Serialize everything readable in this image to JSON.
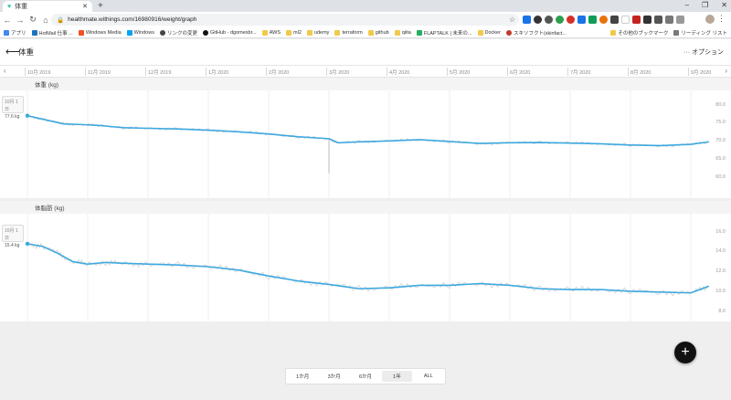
{
  "browser": {
    "tab_title": "体重",
    "url": "healthmate.withings.com/16980916/weight/graph",
    "bookmarks": [
      "アプリ",
      "HotMail 仕事 ...",
      "Windows Media",
      "Windows",
      "リンクの変更",
      "GitHub - dgomesbr...",
      "AWS",
      "ml2",
      "udemy",
      "terraform",
      "github",
      "qiita",
      "FLAPTALK | 未来の...",
      "Docker",
      "スキソフクト(skinfact..."
    ],
    "bookmarks_right": [
      "その他のブックマーク",
      "リーディング リスト"
    ]
  },
  "colors": {
    "series": "#3da9e0",
    "raw": "#cccccc"
  },
  "app": {
    "back_icon": "arrow-left-icon",
    "title": "体重",
    "options": "··· オプション",
    "timeline_months": [
      "10月 2019",
      "11月 2019",
      "12月 2019",
      "1月 2020",
      "2月 2020",
      "3月 2020",
      "4月 2020",
      "5月 2020",
      "6月 2020",
      "7月 2020",
      "8月 2020",
      "9月 2020"
    ]
  },
  "weight_section": {
    "header": "体重 (kg)",
    "tooltip_date": "10月 1日",
    "tooltip_value": "77.6 kg",
    "y_ticks": [
      "80.0",
      "75.0",
      "70.0",
      "65.0",
      "60.0"
    ]
  },
  "fat_section": {
    "header": "体脂肪 (kg)",
    "tooltip_date": "10月 1日",
    "tooltip_value": "15.4 kg",
    "y_ticks": [
      "16.0",
      "14.0",
      "12.0",
      "10.0",
      "8.0"
    ]
  },
  "chart_data": [
    {
      "type": "line",
      "ylabel": "体重 (kg)",
      "ylim": [
        57.5,
        81
      ],
      "x_ticks": [
        "10月 2019",
        "11月 2019",
        "12月 2019",
        "1月 2020",
        "2月 2020",
        "3月 2020",
        "4月 2020",
        "5月 2020",
        "6月 2020",
        "7月 2020",
        "8月 2020",
        "9月 2020"
      ],
      "x": [
        0,
        0.3,
        0.6,
        0.9,
        1.2,
        1.6,
        2.0,
        2.5,
        3.0,
        3.5,
        4.0,
        4.5,
        5.0,
        5.15,
        5.5,
        6.0,
        6.5,
        7.0,
        7.5,
        8.0,
        8.5,
        9.0,
        9.5,
        10.0,
        10.5,
        11.0,
        11.3
      ],
      "values": [
        77.6,
        76.3,
        75.0,
        74.8,
        74.5,
        73.8,
        73.6,
        73.4,
        73.0,
        72.5,
        71.8,
        70.9,
        70.3,
        69.0,
        69.3,
        69.6,
        70.0,
        69.4,
        68.8,
        69.0,
        69.1,
        68.9,
        68.7,
        68.3,
        68.1,
        68.5,
        69.3
      ],
      "raw_dip": {
        "x": 5.0,
        "value": 59.3
      }
    },
    {
      "type": "line",
      "ylabel": "体脂肪 (kg)",
      "ylim": [
        7.2,
        16.8
      ],
      "x_ticks": [
        "10月 2019",
        "11月 2019",
        "12月 2019",
        "1月 2020",
        "2月 2020",
        "3月 2020",
        "4月 2020",
        "5月 2020",
        "6月 2020",
        "7月 2020",
        "8月 2020",
        "9月 2020"
      ],
      "x": [
        0,
        0.25,
        0.5,
        0.75,
        1.0,
        1.3,
        1.6,
        2.0,
        2.5,
        3.0,
        3.5,
        4.0,
        4.5,
        5.0,
        5.5,
        6.0,
        6.5,
        7.0,
        7.5,
        8.0,
        8.5,
        9.0,
        9.5,
        10.0,
        10.5,
        11.0,
        11.3
      ],
      "values": [
        15.4,
        15.1,
        14.3,
        13.3,
        13.0,
        13.2,
        13.1,
        13.0,
        12.9,
        12.7,
        12.3,
        11.6,
        11.0,
        10.6,
        10.1,
        10.2,
        10.5,
        10.5,
        10.7,
        10.5,
        10.1,
        10.0,
        10.0,
        9.8,
        9.7,
        9.6,
        10.4
      ]
    }
  ],
  "fab_icon": "plus-icon",
  "range_buttons": [
    "1か月",
    "3か月",
    "6か月",
    "1年",
    "ALL"
  ],
  "range_active": "1年"
}
